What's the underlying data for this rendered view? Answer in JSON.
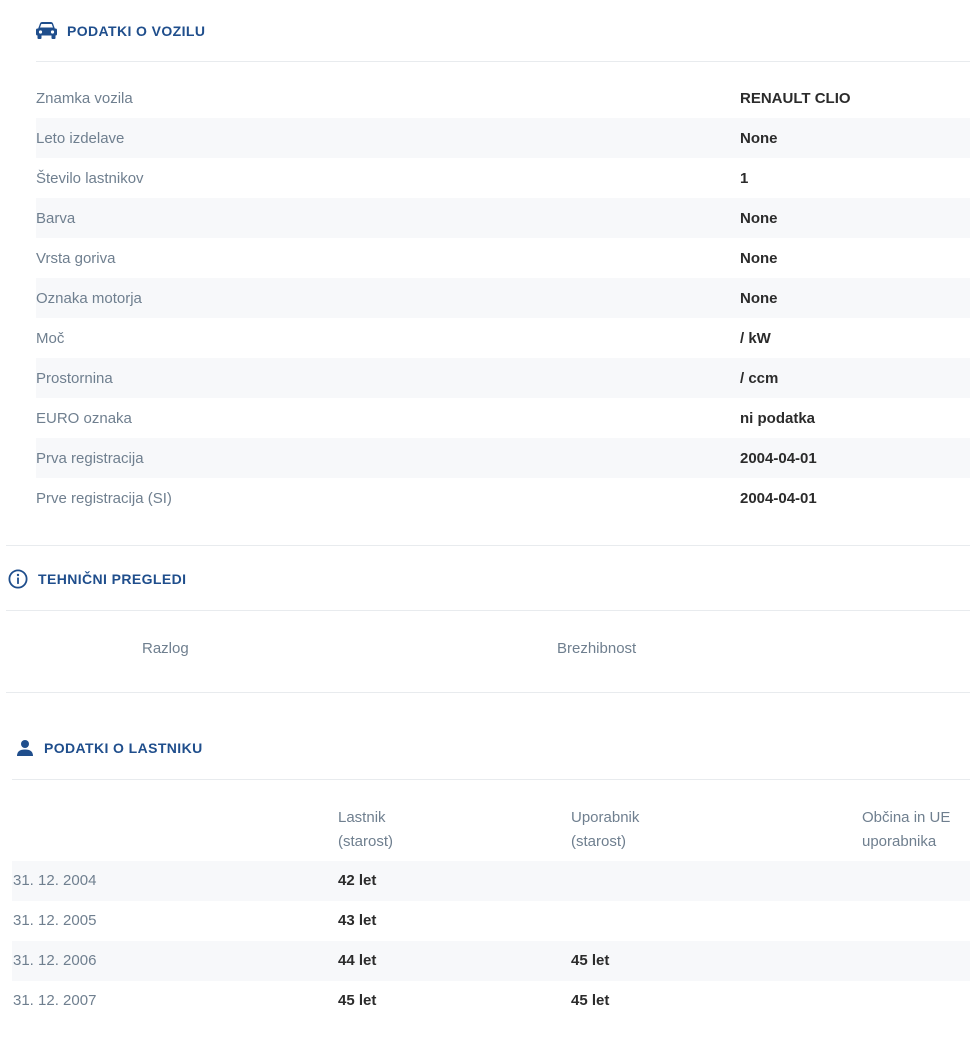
{
  "vehicle": {
    "title": "PODATKI O VOZILU",
    "icon": "car-icon",
    "rows": [
      {
        "label": "Znamka vozila",
        "value": "RENAULT CLIO"
      },
      {
        "label": "Leto izdelave",
        "value": "None"
      },
      {
        "label": "Število lastnikov",
        "value": "1"
      },
      {
        "label": "Barva",
        "value": "None"
      },
      {
        "label": "Vrsta goriva",
        "value": "None"
      },
      {
        "label": "Oznaka motorja",
        "value": "None"
      },
      {
        "label": "Moč",
        "value": "/ kW"
      },
      {
        "label": "Prostornina",
        "value": "/ ccm"
      },
      {
        "label": "EURO oznaka",
        "value": "ni podatka"
      },
      {
        "label": "Prva registracija",
        "value": "2004-04-01"
      },
      {
        "label": "Prve registracija (SI)",
        "value": "2004-04-01"
      }
    ]
  },
  "inspections": {
    "title": "TEHNIČNI PREGLEDI",
    "icon": "info-icon",
    "columns": [
      "Razlog",
      "Brezhibnost"
    ]
  },
  "owner": {
    "title": "PODATKI O LASTNIKU",
    "icon": "person-icon",
    "columns": [
      {
        "line1": "Lastnik",
        "line2": "(starost)"
      },
      {
        "line1": "Uporabnik",
        "line2": "(starost)"
      },
      {
        "line1": "Občina in UE",
        "line2": "uporabnika"
      }
    ],
    "rows": [
      {
        "date": "31. 12. 2004",
        "owner_age": "42 let",
        "user_age": ""
      },
      {
        "date": "31. 12. 2005",
        "owner_age": "43 let",
        "user_age": ""
      },
      {
        "date": "31. 12. 2006",
        "owner_age": "44 let",
        "user_age": "45 let"
      },
      {
        "date": "31. 12. 2007",
        "owner_age": "45 let",
        "user_age": "45 let"
      }
    ]
  },
  "colors": {
    "accent": "#1f4e8c",
    "label": "#6f7f8f",
    "stripe": "#f7f8fa",
    "divider": "#e8ebee"
  }
}
